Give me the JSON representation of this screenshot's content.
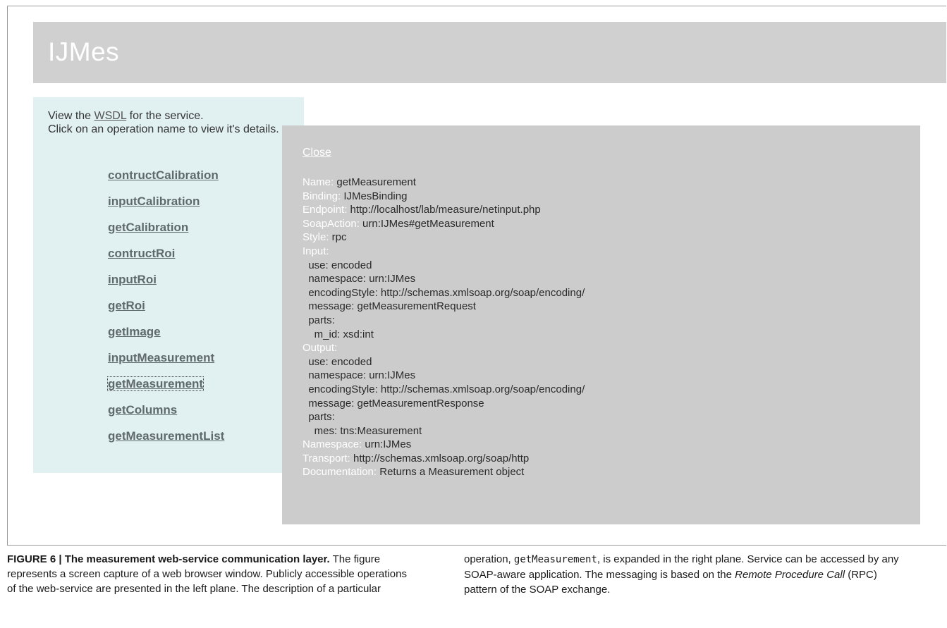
{
  "header": {
    "title": "IJMes"
  },
  "intro": {
    "line1_prefix": "View the ",
    "wsdl_link": "WSDL",
    "line1_suffix": " for the service.",
    "line2": "Click on an operation name to view it's details."
  },
  "operations": [
    "contructCalibration",
    "inputCalibration",
    "getCalibration",
    "contructRoi",
    "inputRoi",
    "getRoi",
    "getImage",
    "inputMeasurement",
    "getMeasurement",
    "getColumns",
    "getMeasurementList"
  ],
  "detail": {
    "close_label": "Close",
    "rows": [
      {
        "key": "Name:",
        "value": " getMeasurement"
      },
      {
        "key": "Binding:",
        "value": " IJMesBinding"
      },
      {
        "key": "Endpoint:",
        "value": " http://localhost/lab/measure/netinput.php"
      },
      {
        "key": "SoapAction:",
        "value": " urn:IJMes#getMeasurement"
      },
      {
        "key": "Style:",
        "value": " rpc"
      },
      {
        "key": "Input:",
        "value": ""
      },
      {
        "key": "",
        "value": "  use: encoded"
      },
      {
        "key": "",
        "value": "  namespace: urn:IJMes"
      },
      {
        "key": "",
        "value": "  encodingStyle: http://schemas.xmlsoap.org/soap/encoding/"
      },
      {
        "key": "",
        "value": "  message: getMeasurementRequest"
      },
      {
        "key": "",
        "value": "  parts:"
      },
      {
        "key": "",
        "value": "    m_id: xsd:int"
      },
      {
        "key": "Output:",
        "value": ""
      },
      {
        "key": "",
        "value": "  use: encoded"
      },
      {
        "key": "",
        "value": "  namespace: urn:IJMes"
      },
      {
        "key": "",
        "value": "  encodingStyle: http://schemas.xmlsoap.org/soap/encoding/"
      },
      {
        "key": "",
        "value": "  message: getMeasurementResponse"
      },
      {
        "key": "",
        "value": "  parts:"
      },
      {
        "key": "",
        "value": "    mes: tns:Measurement"
      },
      {
        "key": "Namespace:",
        "value": " urn:IJMes"
      },
      {
        "key": "Transport:",
        "value": " http://schemas.xmlsoap.org/soap/http"
      },
      {
        "key": "Documentation:",
        "value": " Returns a Measurement object"
      }
    ]
  },
  "caption": {
    "figure_label": "FIGURE 6 | The measurement web-service communication layer.",
    "left_text": " The figure represents a screen capture of a web browser window. Publicly accessible operations of the web-service are presented in the left plane. The description of a particular",
    "right_text1": "operation, ",
    "right_code": "getMeasurement",
    "right_text2": ", is expanded in the right plane. Service can be accessed by any SOAP-aware application. The messaging is based on the ",
    "right_italic": "Remote Procedure Call",
    "right_text3": " (RPC) pattern of the SOAP exchange."
  }
}
